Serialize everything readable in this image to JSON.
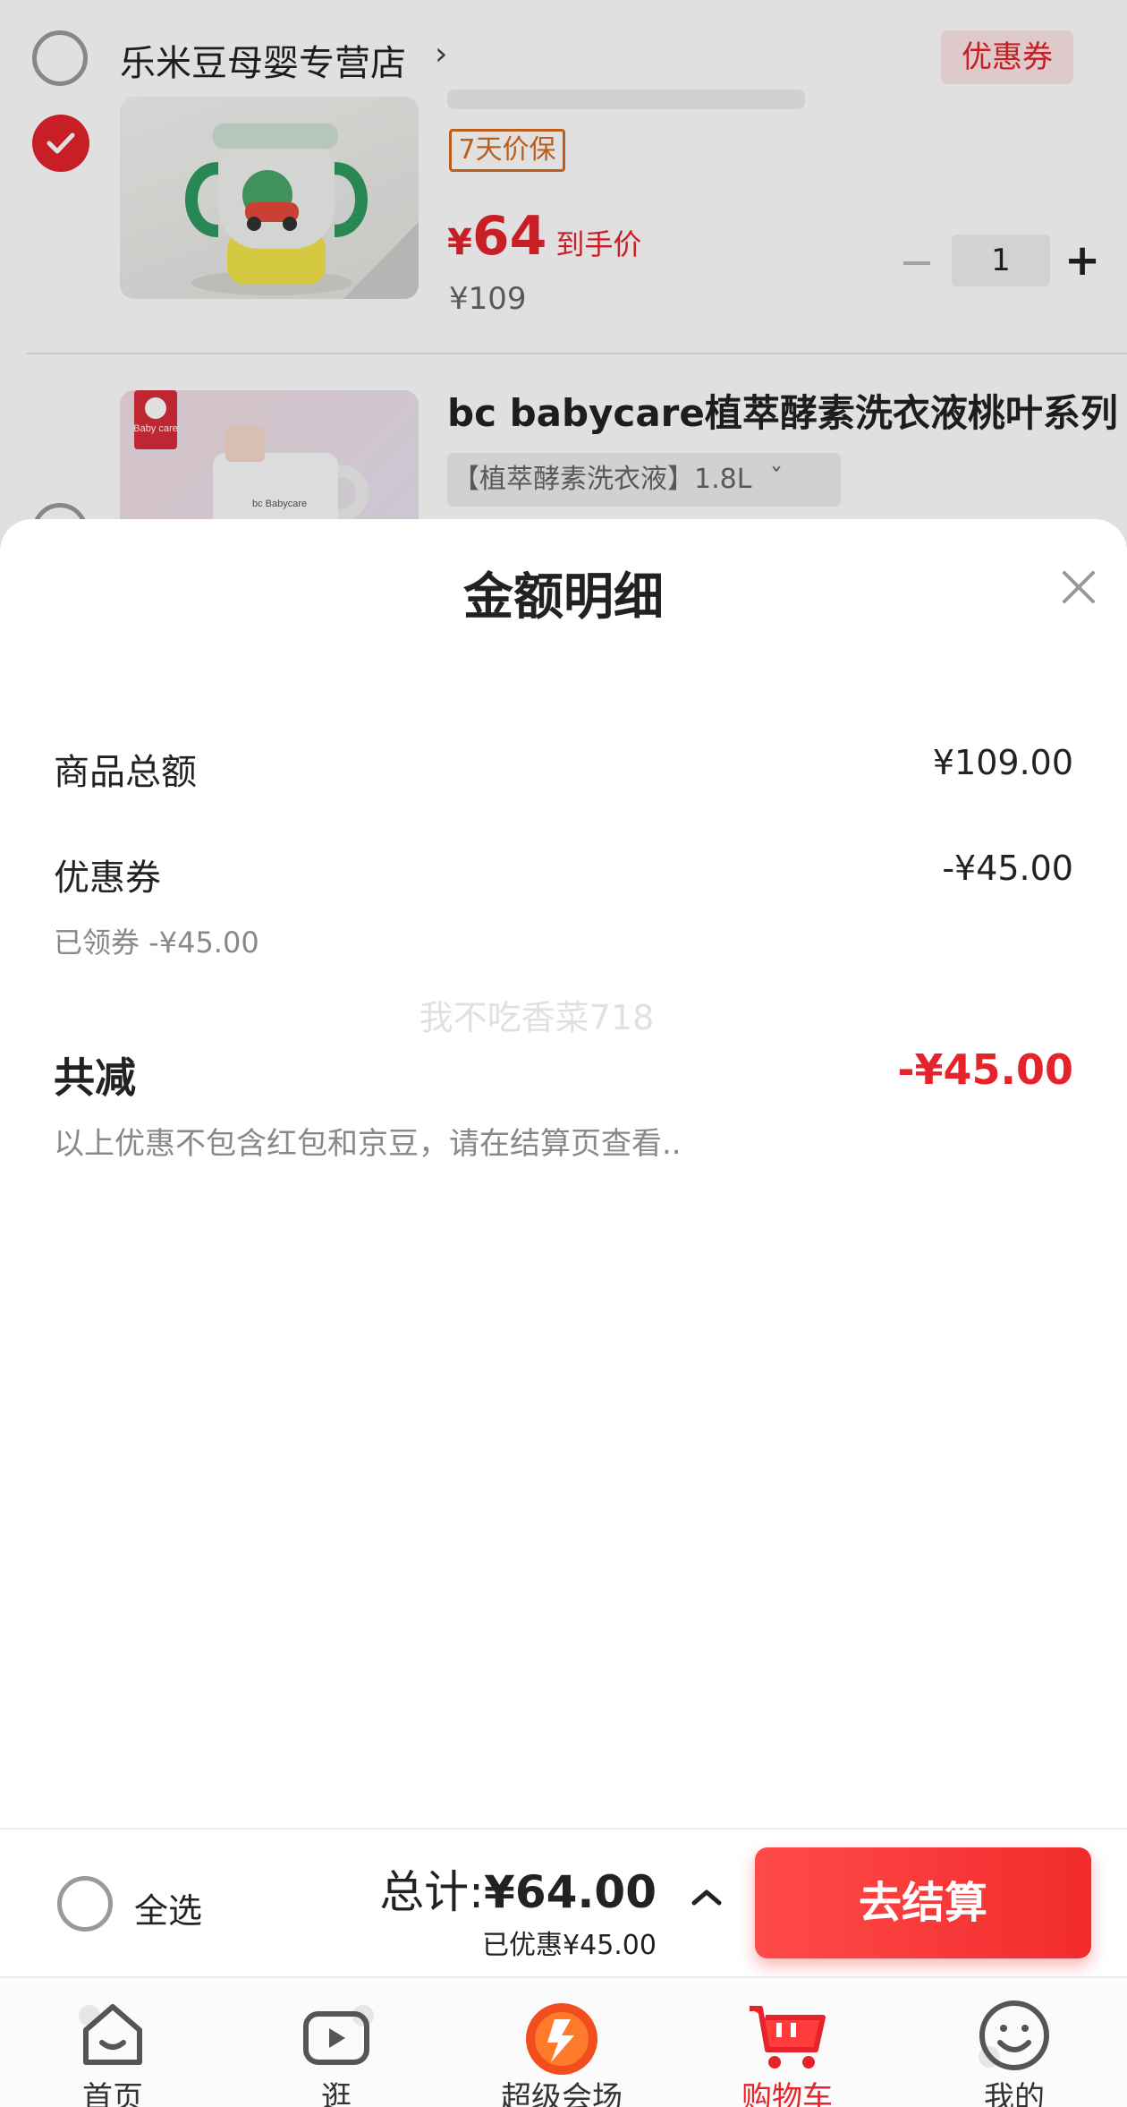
{
  "background": {
    "store": {
      "name": "乐米豆母婴专营店",
      "arrow": "›",
      "coupon_label": "优惠券"
    },
    "item1": {
      "guarantee": "7天价保",
      "price_symbol": "¥",
      "price": "64",
      "price_suffix": "到手价",
      "original_price": "¥109",
      "quantity": "1",
      "plus_symbol": "+"
    },
    "item2": {
      "title": "bc babycare植萃酵素洗衣液桃叶系列",
      "sku": "【植萃酵素洗衣液】1.8L",
      "sku_chevron": "ˇ",
      "image_brand": "Baby care",
      "bottle_label": "bc Babycare"
    }
  },
  "sheet": {
    "title": "金额明细",
    "rows": {
      "goods_total": {
        "label": "商品总额",
        "value": "¥109.00"
      },
      "coupon": {
        "label": "优惠券",
        "value": "-¥45.00",
        "note": "已领券 -¥45.00"
      }
    },
    "watermark": "我不吃香菜718",
    "total_reduction": {
      "label": "共减",
      "value": "-¥45.00"
    },
    "footnote": "以上优惠不包含红包和京豆，请在结算页查看.."
  },
  "checkout": {
    "select_all": "全选",
    "total_prefix": "总计:",
    "total_value": "¥64.00",
    "saved": "已优惠¥45.00",
    "button": "去结算"
  },
  "tabs": [
    {
      "label": "首页",
      "icon": "home-icon"
    },
    {
      "label": "逛",
      "icon": "video-icon"
    },
    {
      "label": "超级会场",
      "icon": "super-venue-icon"
    },
    {
      "label": "购物车",
      "icon": "cart-icon",
      "active": true
    },
    {
      "label": "我的",
      "icon": "profile-icon"
    }
  ],
  "colors": {
    "accent": "#e4232b",
    "muted": "#888888",
    "guarantee": "#d86a1e"
  }
}
